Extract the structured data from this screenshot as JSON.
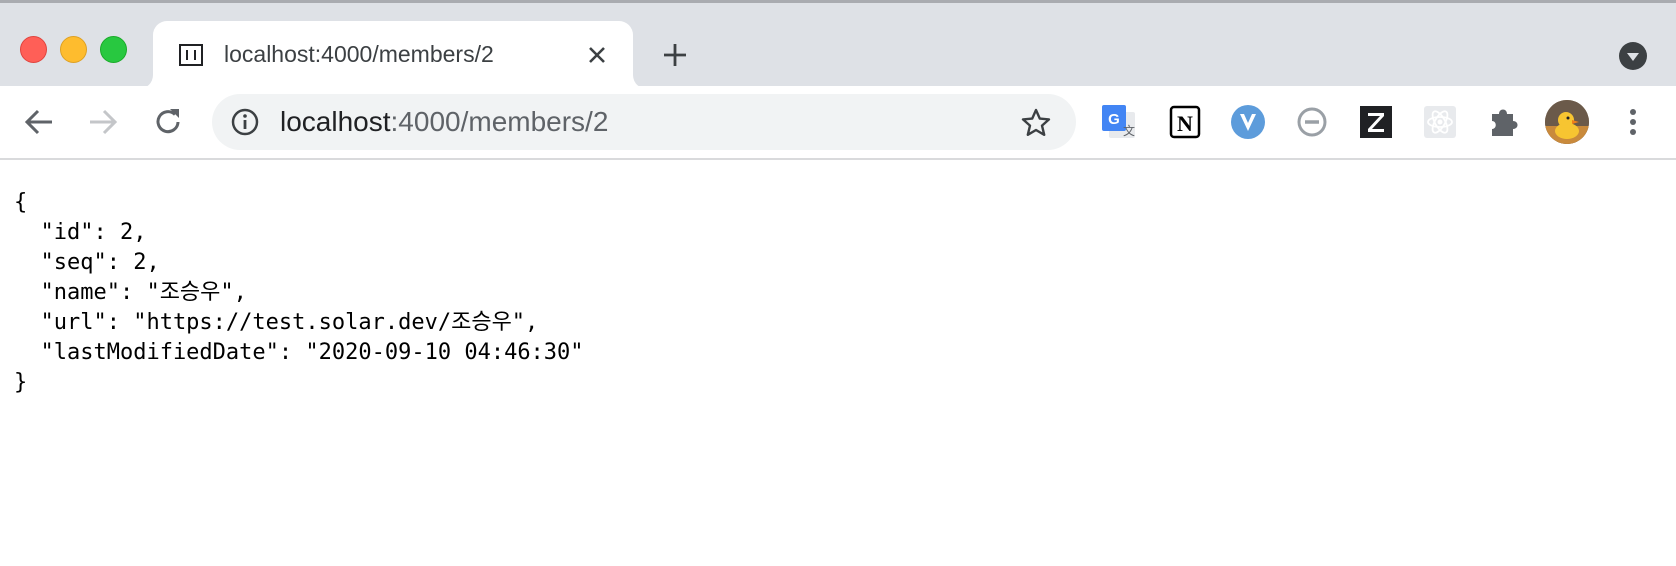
{
  "tab": {
    "title": "localhost:4000/members/2"
  },
  "omnibox": {
    "host": "localhost",
    "rest": ":4000/members/2"
  },
  "icons": {
    "back": "back-arrow-icon",
    "forward": "forward-arrow-icon",
    "reload": "reload-icon",
    "site_info": "info-icon",
    "bookmark": "star-icon",
    "new_tab": "plus-icon",
    "tab_search": "chevron-down-icon",
    "menu": "kebab-menu-icon"
  },
  "extensions": [
    "google-translate-icon",
    "notion-icon",
    "vue-devtools-icon",
    "blocker-icon",
    "zotero-icon",
    "react-devtools-icon",
    "puzzle-icon"
  ],
  "json_view": {
    "open": "{",
    "lines": [
      "  \"id\": 2,",
      "  \"seq\": 2,",
      "  \"name\": \"조승우\",",
      "  \"url\": \"https://test.solar.dev/조승우\",",
      "  \"lastModifiedDate\": \"2020-09-10 04:46:30\""
    ],
    "close": "}"
  },
  "colors": {
    "tabstrip": "#dee1e6",
    "omnibox": "#f1f3f4",
    "text": "#202124"
  }
}
